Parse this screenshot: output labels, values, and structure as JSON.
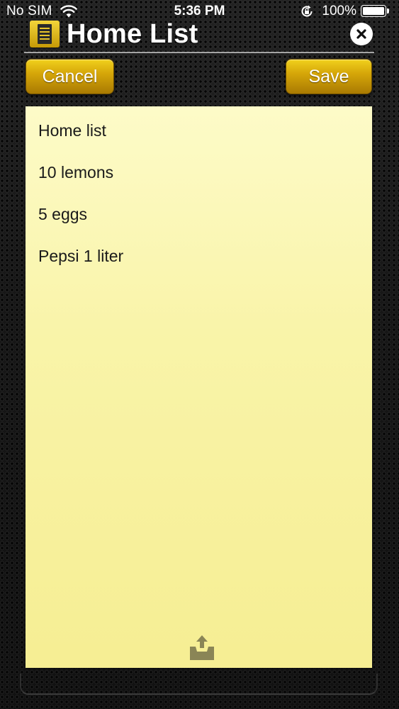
{
  "status_bar": {
    "carrier": "No SIM",
    "time": "5:36 PM",
    "battery": "100%",
    "battery_level": 1.0,
    "icons": [
      "wifi-icon",
      "orientation-lock-icon",
      "battery-icon"
    ]
  },
  "header": {
    "title": "Home List",
    "icon": "notepad-icon",
    "close_icon": "close-icon"
  },
  "toolbar": {
    "cancel_label": "Cancel",
    "save_label": "Save"
  },
  "note": {
    "lines": [
      "Home list",
      "10 lemons",
      "5 eggs",
      "Pepsi 1 liter"
    ],
    "share_icon": "share-icon"
  },
  "colors": {
    "accent_gold": "#d6a709",
    "paper": "#f9f4a9",
    "background": "#151515"
  }
}
